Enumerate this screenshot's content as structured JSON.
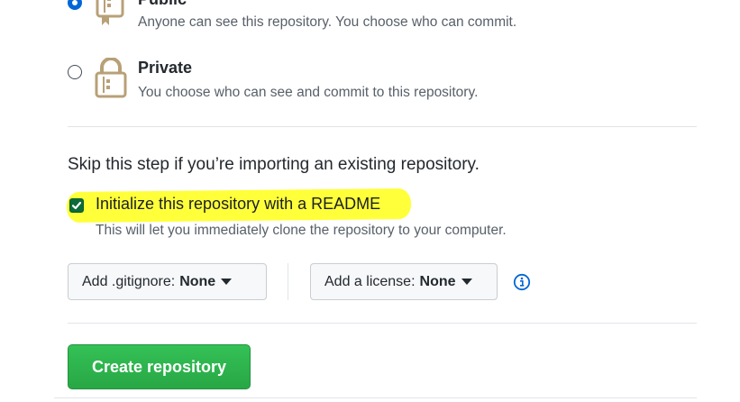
{
  "visibility": {
    "public": {
      "title": "Public",
      "description": "Anyone can see this repository. You choose who can commit.",
      "selected": true
    },
    "private": {
      "title": "Private",
      "description": "You choose who can see and commit to this repository.",
      "selected": false
    }
  },
  "skip_note": "Skip this step if you’re importing an existing repository.",
  "readme": {
    "label": "Initialize this repository with a README",
    "description": "This will let you immediately clone the repository to your computer.",
    "checked": true,
    "highlight_color": "#ffff3a"
  },
  "gitignore": {
    "label": "Add .gitignore:",
    "value": "None"
  },
  "license": {
    "label": "Add a license:",
    "value": "None"
  },
  "info_icon": "info-icon",
  "create_button": {
    "label": "Create repository",
    "color": "#28a745"
  },
  "colors": {
    "radio_selected": "#0366d6",
    "checkbox": "#0b6b3a"
  }
}
